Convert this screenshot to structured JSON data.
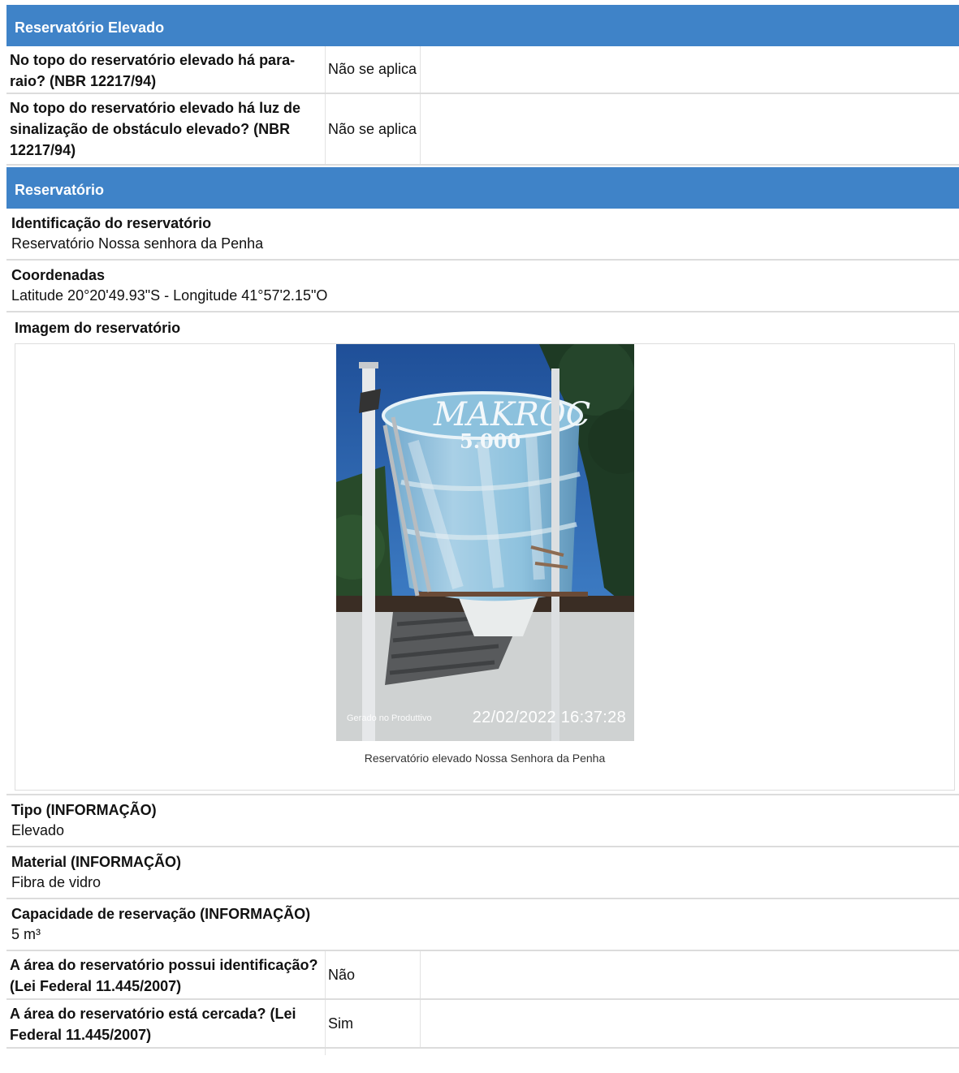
{
  "section_elevado": {
    "title": "Reservatório Elevado",
    "rows": [
      {
        "question": "No topo do reservatório elevado há para-raio? (NBR 12217/94)",
        "answer": "Não se aplica"
      },
      {
        "question": "No topo do reservatório elevado há luz de sinalização de obstáculo elevado? (NBR 12217/94)",
        "answer": "Não se aplica"
      }
    ]
  },
  "section_reservatorio": {
    "title": "Reservatório",
    "identificacao": {
      "label": "Identificação do reservatório",
      "value": "Reservatório Nossa senhora da Penha"
    },
    "coordenadas": {
      "label": "Coordenadas",
      "value": "Latitude 20°20'49.93\"S - Longitude 41°57'2.15\"O"
    },
    "imagem": {
      "label": "Imagem do reservatório",
      "photo_tank_text": "MAKROC",
      "photo_tank_capacity_text": "5.000",
      "photo_stamp_small": "Gerado no Produttivo",
      "photo_stamp_datetime": "22/02/2022 16:37:28",
      "caption": "Reservatório elevado Nossa Senhora da Penha"
    },
    "tipo": {
      "label": "Tipo (INFORMAÇÃO)",
      "value": "Elevado"
    },
    "material": {
      "label": "Material (INFORMAÇÃO)",
      "value": "Fibra de vidro"
    },
    "capacidade": {
      "label": "Capacidade de reservação (INFORMAÇÃO)",
      "value": "5 m³"
    },
    "rows": [
      {
        "question": "A área do reservatório possui identificação? (Lei Federal 11.445/2007)",
        "answer": "Não"
      },
      {
        "question": "A área do reservatório está cercada? (Lei Federal 11.445/2007)",
        "answer": "Sim"
      }
    ]
  }
}
